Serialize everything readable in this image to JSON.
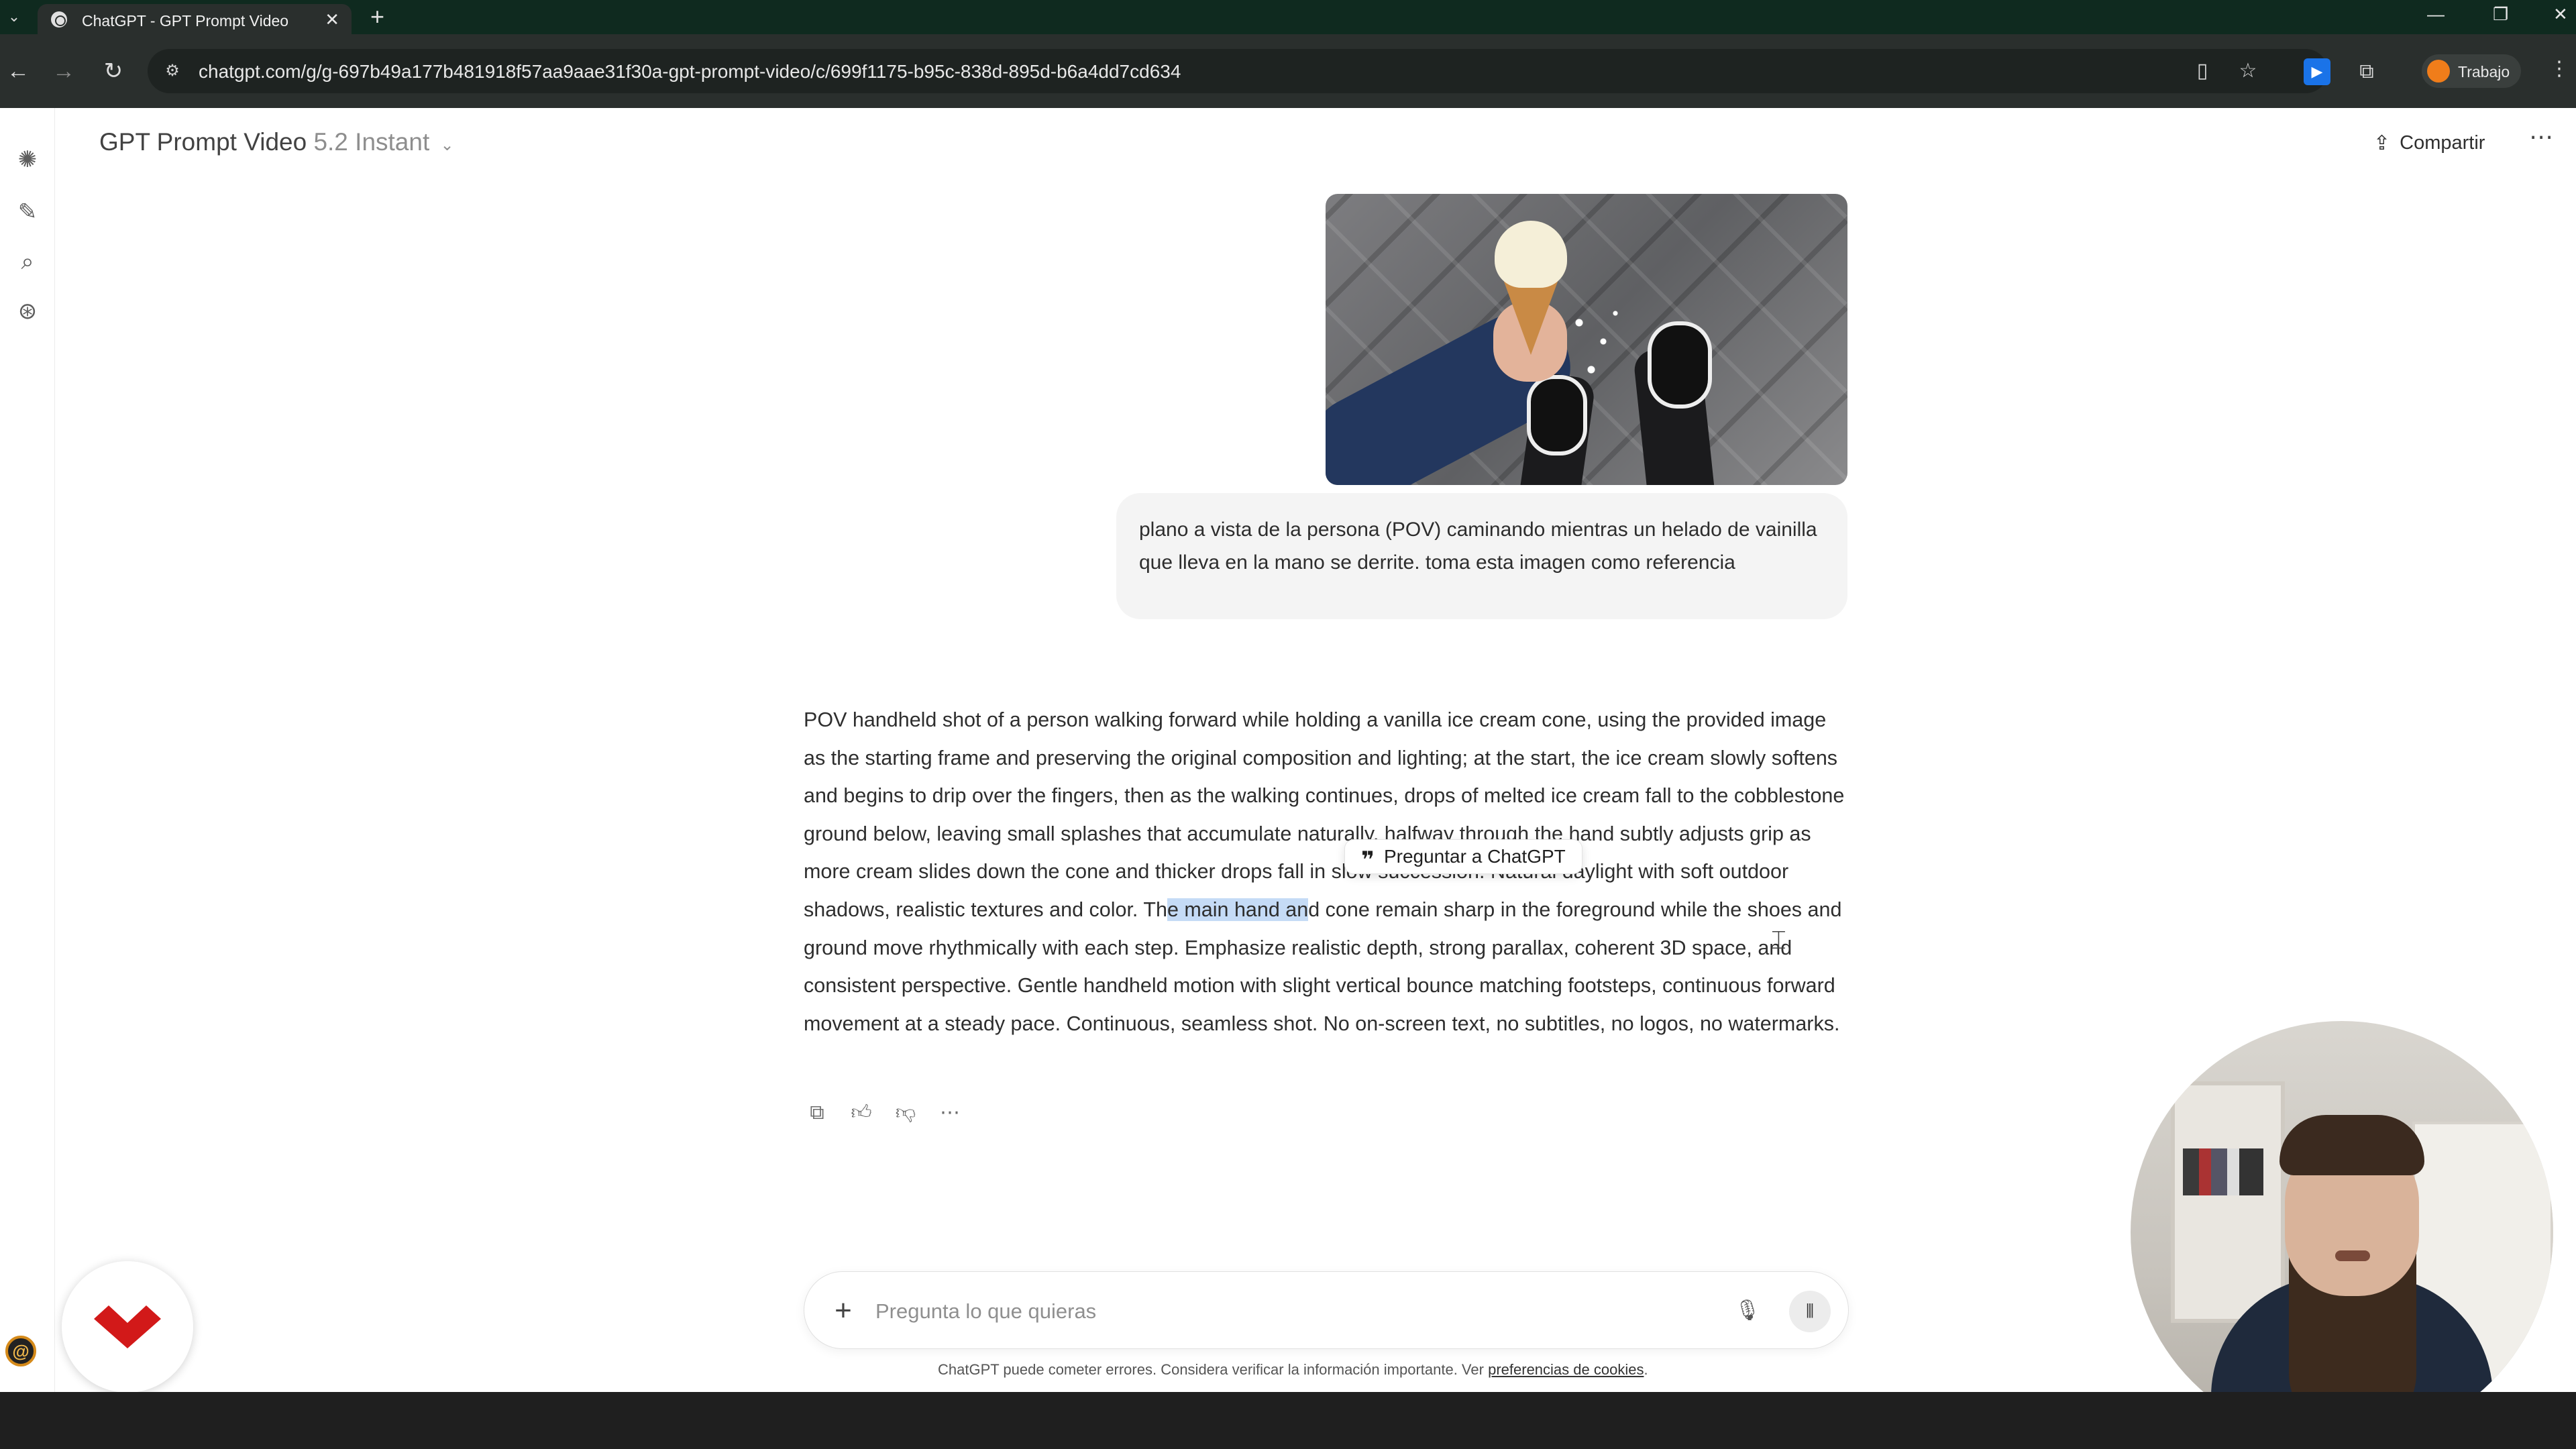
{
  "browser": {
    "tab_title": "ChatGPT - GPT Prompt Video",
    "url": "chatgpt.com/g/g-697b49a177b481918f57aa9aae31f30a-gpt-prompt-video/c/699f1175-b95c-838d-895d-b6a4dd7cd634",
    "profile_name": "Trabajo",
    "icons": {
      "tab_menu": "chevron-down-icon",
      "close_tab": "close-icon",
      "new_tab": "plus-icon",
      "back": "arrow-left-icon",
      "forward": "arrow-right-icon",
      "reload": "reload-icon",
      "site_info": "tune-icon",
      "page": "document-icon",
      "bookmark": "star-icon",
      "extension_blue": "play-extension-icon",
      "extensions": "puzzle-icon",
      "menu": "kebab-icon"
    }
  },
  "header": {
    "gpt_name": "GPT Prompt Video",
    "model": "5.2 Instant",
    "share_label": "Compartir"
  },
  "conversation": {
    "user_message": "plano a vista de la persona (POV) caminando mientras un helado de vainilla que lleva en la mano se derrite. toma esta imagen como referencia",
    "assistant": {
      "text_before": "POV handheld shot of a person walking forward while holding a vanilla ice cream cone, using the provided image as the starting frame and preserving the original composition and lighting; at the start, the ice cream slowly softens and begins to drip over the fingers, then as the walking continues, drops of melted ice cream fall to the cobblestone ground below, leaving small splashes that accumulate naturally, halfway through the hand subtly adjusts grip as more cream slides down the cone and thicker drops fall in slow succession. Natural daylight with soft outdoor shadows, realistic textures and color. Th",
      "highlighted": "e main hand an",
      "text_after": "d cone remain sharp in the foreground while the shoes and ground move rhythmically with each step. Emphasize realistic depth, strong parallax, coherent 3D space, and consistent perspective. Gentle handheld motion with slight vertical bounce matching footsteps, continuous forward movement at a steady pace. Continuous, seamless shot. No on-screen text, no subtitles, no logos, no watermarks."
    },
    "selection_tooltip": "Preguntar a ChatGPT"
  },
  "composer": {
    "placeholder": "Pregunta lo que quieras",
    "disclaimer": "ChatGPT puede cometer errores. Considera verificar la información importante. Ver",
    "disclaimer_link": "preferencias de cookies",
    "disclaimer_end": "."
  },
  "colors": {
    "selection": "#c5dbf6",
    "brand_red": "#d21919",
    "profile": "#f07d1a"
  }
}
